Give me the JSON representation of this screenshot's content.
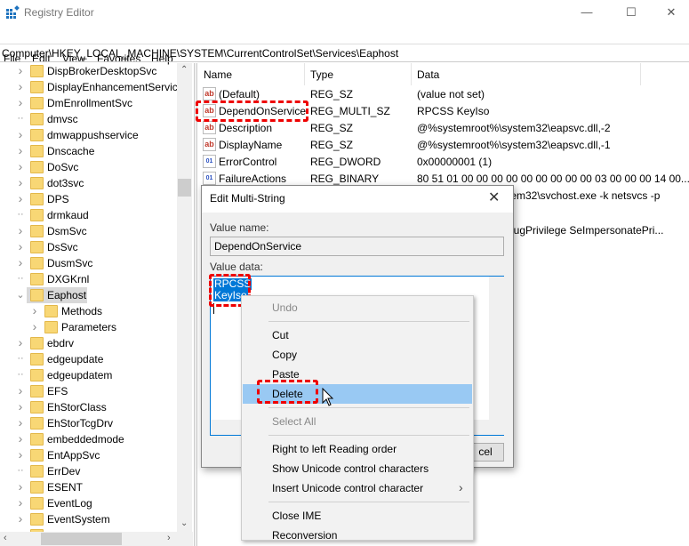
{
  "window": {
    "title": "Registry Editor",
    "minimize": "—",
    "maximize": "☐",
    "close": "✕"
  },
  "menu": [
    "File",
    "Edit",
    "View",
    "Favorites",
    "Help"
  ],
  "address": "Computer\\HKEY_LOCAL_MACHINE\\SYSTEM\\CurrentControlSet\\Services\\Eaphost",
  "tree": [
    {
      "label": "DispBrokerDesktopSvc",
      "exp": true,
      "lvl": 0
    },
    {
      "label": "DisplayEnhancementService",
      "exp": true,
      "lvl": 0
    },
    {
      "label": "DmEnrollmentSvc",
      "exp": true,
      "lvl": 0
    },
    {
      "label": "dmvsc",
      "exp": false,
      "lvl": 0
    },
    {
      "label": "dmwappushservice",
      "exp": true,
      "lvl": 0
    },
    {
      "label": "Dnscache",
      "exp": true,
      "lvl": 0
    },
    {
      "label": "DoSvc",
      "exp": true,
      "lvl": 0
    },
    {
      "label": "dot3svc",
      "exp": true,
      "lvl": 0
    },
    {
      "label": "DPS",
      "exp": true,
      "lvl": 0
    },
    {
      "label": "drmkaud",
      "exp": false,
      "lvl": 0
    },
    {
      "label": "DsmSvc",
      "exp": true,
      "lvl": 0
    },
    {
      "label": "DsSvc",
      "exp": true,
      "lvl": 0
    },
    {
      "label": "DusmSvc",
      "exp": true,
      "lvl": 0
    },
    {
      "label": "DXGKrnl",
      "exp": false,
      "lvl": 0
    },
    {
      "label": "Eaphost",
      "exp": "open",
      "lvl": 0,
      "selected": true
    },
    {
      "label": "Methods",
      "exp": true,
      "lvl": 1
    },
    {
      "label": "Parameters",
      "exp": true,
      "lvl": 1
    },
    {
      "label": "ebdrv",
      "exp": true,
      "lvl": 0
    },
    {
      "label": "edgeupdate",
      "exp": false,
      "lvl": 0
    },
    {
      "label": "edgeupdatem",
      "exp": false,
      "lvl": 0
    },
    {
      "label": "EFS",
      "exp": true,
      "lvl": 0
    },
    {
      "label": "EhStorClass",
      "exp": true,
      "lvl": 0
    },
    {
      "label": "EhStorTcgDrv",
      "exp": true,
      "lvl": 0
    },
    {
      "label": "embeddedmode",
      "exp": true,
      "lvl": 0
    },
    {
      "label": "EntAppSvc",
      "exp": true,
      "lvl": 0
    },
    {
      "label": "ErrDev",
      "exp": false,
      "lvl": 0
    },
    {
      "label": "ESENT",
      "exp": true,
      "lvl": 0
    },
    {
      "label": "EventLog",
      "exp": true,
      "lvl": 0
    },
    {
      "label": "EventSystem",
      "exp": true,
      "lvl": 0
    }
  ],
  "list": {
    "headers": {
      "name": "Name",
      "type": "Type",
      "data": "Data"
    },
    "rows": [
      {
        "icon": "ab",
        "name": "(Default)",
        "type": "REG_SZ",
        "data": "(value not set)"
      },
      {
        "icon": "ab",
        "name": "DependOnService",
        "type": "REG_MULTI_SZ",
        "data": "RPCSS KeyIso"
      },
      {
        "icon": "ab",
        "name": "Description",
        "type": "REG_SZ",
        "data": "@%systemroot%\\system32\\eapsvc.dll,-2"
      },
      {
        "icon": "ab",
        "name": "DisplayName",
        "type": "REG_SZ",
        "data": "@%systemroot%\\system32\\eapsvc.dll,-1"
      },
      {
        "icon": "bin",
        "name": "ErrorControl",
        "type": "REG_DWORD",
        "data": "0x00000001 (1)"
      },
      {
        "icon": "bin",
        "name": "FailureActions",
        "type": "REG_BINARY",
        "data": "80 51 01 00 00 00 00 00 00 00 00 00 03 00 00 00 14 00..."
      }
    ],
    "partial_data": [
      "tem32\\svchost.exe -k netsvcs -p",
      "bugPrivilege SeImpersonatePri..."
    ]
  },
  "dialog": {
    "title": "Edit Multi-String",
    "close": "✕",
    "value_name_label": "Value name:",
    "value_name": "DependOnService",
    "value_data_label": "Value data:",
    "value_data": [
      "RPCSS",
      "KeyIso"
    ],
    "cancel_partial": "cel"
  },
  "context_menu": [
    {
      "label": "Undo",
      "disabled": true
    },
    {
      "sep": true
    },
    {
      "label": "Cut"
    },
    {
      "label": "Copy"
    },
    {
      "label": "Paste"
    },
    {
      "label": "Delete",
      "highlight": true
    },
    {
      "sep": true
    },
    {
      "label": "Select All",
      "disabled": true
    },
    {
      "sep": true
    },
    {
      "label": "Right to left Reading order"
    },
    {
      "label": "Show Unicode control characters"
    },
    {
      "label": "Insert Unicode control character",
      "submenu": true
    },
    {
      "sep": true
    },
    {
      "label": "Close IME"
    },
    {
      "label": "Reconversion"
    }
  ]
}
